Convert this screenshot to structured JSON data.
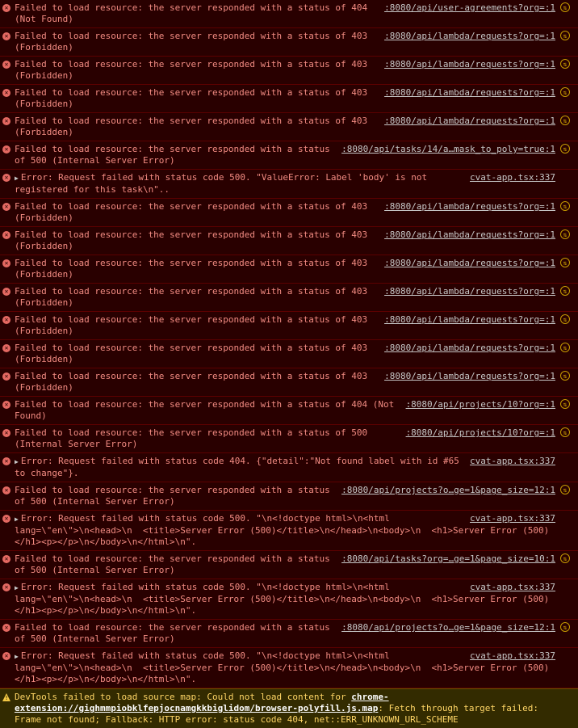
{
  "colors": {
    "error_bg": "#290000",
    "error_text": "#f28b82",
    "warning_bg": "#332b00",
    "warning_text": "#ffd666"
  },
  "entries": [
    {
      "kind": "net",
      "msg": "Failed to load resource: the server responded with a status of 404 (Not Found)",
      "src": ":8080/api/user-agreements?org=:1"
    },
    {
      "kind": "net",
      "msg": "Failed to load resource: the server responded with a status of 403 (Forbidden)",
      "src": ":8080/api/lambda/requests?org=:1"
    },
    {
      "kind": "net",
      "msg": "Failed to load resource: the server responded with a status of 403 (Forbidden)",
      "src": ":8080/api/lambda/requests?org=:1"
    },
    {
      "kind": "net",
      "msg": "Failed to load resource: the server responded with a status of 403 (Forbidden)",
      "src": ":8080/api/lambda/requests?org=:1"
    },
    {
      "kind": "net",
      "msg": "Failed to load resource: the server responded with a status of 403 (Forbidden)",
      "src": ":8080/api/lambda/requests?org=:1"
    },
    {
      "kind": "net",
      "msg": "Failed to load resource: the server responded with a status of 500 (Internal Server Error)",
      "src": ":8080/api/tasks/14/a…mask_to_poly=true:1"
    },
    {
      "kind": "obj",
      "msg": "Error: Request failed with status code 500. \"ValueError: Label 'body' is not registered for this task\\n\"..",
      "src": "cvat-app.tsx:337"
    },
    {
      "kind": "net",
      "msg": "Failed to load resource: the server responded with a status of 403 (Forbidden)",
      "src": ":8080/api/lambda/requests?org=:1"
    },
    {
      "kind": "net",
      "msg": "Failed to load resource: the server responded with a status of 403 (Forbidden)",
      "src": ":8080/api/lambda/requests?org=:1"
    },
    {
      "kind": "net",
      "msg": "Failed to load resource: the server responded with a status of 403 (Forbidden)",
      "src": ":8080/api/lambda/requests?org=:1"
    },
    {
      "kind": "net",
      "msg": "Failed to load resource: the server responded with a status of 403 (Forbidden)",
      "src": ":8080/api/lambda/requests?org=:1"
    },
    {
      "kind": "net",
      "msg": "Failed to load resource: the server responded with a status of 403 (Forbidden)",
      "src": ":8080/api/lambda/requests?org=:1"
    },
    {
      "kind": "net",
      "msg": "Failed to load resource: the server responded with a status of 403 (Forbidden)",
      "src": ":8080/api/lambda/requests?org=:1"
    },
    {
      "kind": "net",
      "msg": "Failed to load resource: the server responded with a status of 403 (Forbidden)",
      "src": ":8080/api/lambda/requests?org=:1"
    },
    {
      "kind": "net",
      "msg": "Failed to load resource: the server responded with a status of 404 (Not Found)",
      "src": ":8080/api/projects/10?org=:1"
    },
    {
      "kind": "net",
      "msg": "Failed to load resource: the server responded with a status of 500 (Internal Server Error)",
      "src": ":8080/api/projects/10?org=:1"
    },
    {
      "kind": "obj",
      "msg": "Error: Request failed with status code 404. {\"detail\":\"Not found label with id #65 to change\"}.",
      "src": "cvat-app.tsx:337"
    },
    {
      "kind": "net",
      "msg": "Failed to load resource: the server responded with a status of 500 (Internal Server Error)",
      "src": ":8080/api/projects?o…ge=1&page_size=12:1"
    },
    {
      "kind": "obj",
      "msg": "Error: Request failed with status code 500. \"\\n<!doctype html>\\n<html lang=\\\"en\\\">\\n<head>\\n  <title>Server Error (500)</title>\\n</head>\\n<body>\\n  <h1>Server Error (500)</h1><p></p>\\n</body>\\n</html>\\n\".",
      "src": "cvat-app.tsx:337"
    },
    {
      "kind": "net",
      "msg": "Failed to load resource: the server responded with a status of 500 (Internal Server Error)",
      "src": ":8080/api/tasks?org=…ge=1&page_size=10:1"
    },
    {
      "kind": "obj",
      "msg": "Error: Request failed with status code 500. \"\\n<!doctype html>\\n<html lang=\\\"en\\\">\\n<head>\\n  <title>Server Error (500)</title>\\n</head>\\n<body>\\n  <h1>Server Error (500)</h1><p></p>\\n</body>\\n</html>\\n\".",
      "src": "cvat-app.tsx:337"
    },
    {
      "kind": "net",
      "msg": "Failed to load resource: the server responded with a status of 500 (Internal Server Error)",
      "src": ":8080/api/projects?o…ge=1&page_size=12:1"
    },
    {
      "kind": "obj",
      "msg": "Error: Request failed with status code 500. \"\\n<!doctype html>\\n<html lang=\\\"en\\\">\\n<head>\\n  <title>Server Error (500)</title>\\n</head>\\n<body>\\n  <h1>Server Error (500)</h1><p></p>\\n</body>\\n</html>\\n\".",
      "src": "cvat-app.tsx:337"
    }
  ],
  "warning": {
    "prefix": "DevTools failed to load source map: Could not load content for ",
    "link": "chrome-extension://gighmmpiobklfepjocnamgkkbiglidom/browser-polyfill.js.map",
    "suffix": ": Fetch through target failed: Frame not found; Fallback: HTTP error: status code 404, net::ERR_UNKNOWN_URL_SCHEME"
  }
}
